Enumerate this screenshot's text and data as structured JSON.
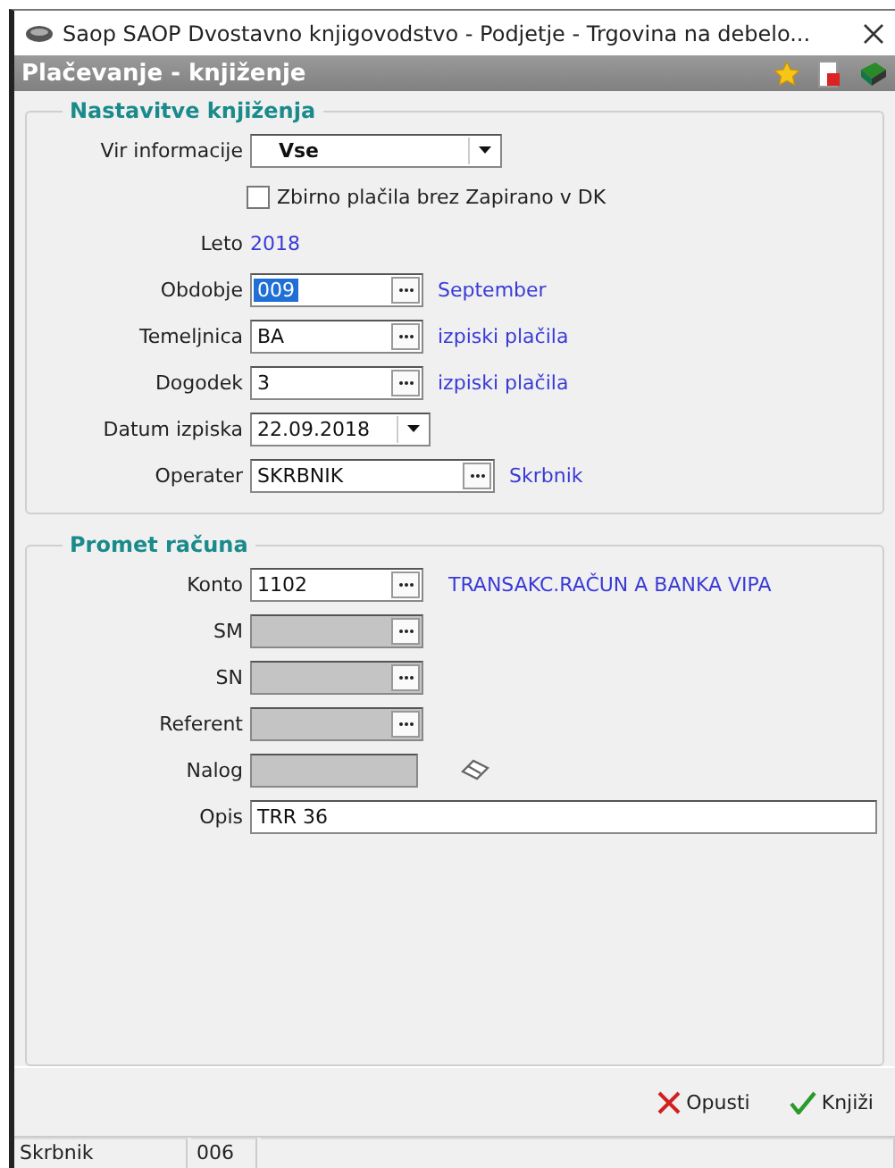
{
  "window": {
    "title": "Saop SAOP Dvostavno knjigovodstvo - Podjetje - Trgovina na debelo..."
  },
  "header": {
    "title": "Plačevanje - knjiženje"
  },
  "groups": [
    {
      "title": "Nastavitve knjiženja",
      "rows": [
        {
          "kind": "select",
          "label": "Vir informacije",
          "value": "Vse"
        },
        {
          "kind": "checkbox",
          "label": "Zbirno plačila brez Zapirano v DK",
          "checked": false
        },
        {
          "kind": "info",
          "label": "Leto",
          "value": "2018"
        },
        {
          "kind": "lookup",
          "label": "Obdobje",
          "value": "009",
          "highlighted": true,
          "disabled": false,
          "note": "September"
        },
        {
          "kind": "lookup",
          "label": "Temeljnica",
          "value": "BA",
          "highlighted": false,
          "disabled": false,
          "note": "izpiski plačila"
        },
        {
          "kind": "lookup",
          "label": "Dogodek",
          "value": "3",
          "highlighted": false,
          "disabled": false,
          "note": "izpiski plačila"
        },
        {
          "kind": "date",
          "label": "Datum izpiska",
          "value": "22.09.2018"
        },
        {
          "kind": "lookup",
          "label": "Operater",
          "value": "SKRBNIK",
          "highlighted": false,
          "disabled": false,
          "wide": true,
          "note": "Skrbnik"
        }
      ]
    },
    {
      "title": "Promet računa",
      "rows": [
        {
          "kind": "lookup",
          "label": "Konto",
          "value": "1102",
          "highlighted": false,
          "disabled": false,
          "note": "TRANSAKC.RAČUN A BANKA VIPA"
        },
        {
          "kind": "lookup",
          "label": "SM",
          "disabled": true
        },
        {
          "kind": "lookup",
          "label": "SN",
          "disabled": true
        },
        {
          "kind": "lookup",
          "label": "Referent",
          "disabled": true
        },
        {
          "kind": "tagfield",
          "label": "Nalog",
          "disabled": true
        },
        {
          "kind": "text",
          "label": "Opis",
          "value": "TRR 36"
        }
      ]
    }
  ],
  "buttons": [
    {
      "kind": "cancel",
      "label": "Opusti"
    },
    {
      "kind": "ok",
      "label": "Knjiži"
    }
  ],
  "status_bar": [
    "Skrbnik",
    "006"
  ]
}
